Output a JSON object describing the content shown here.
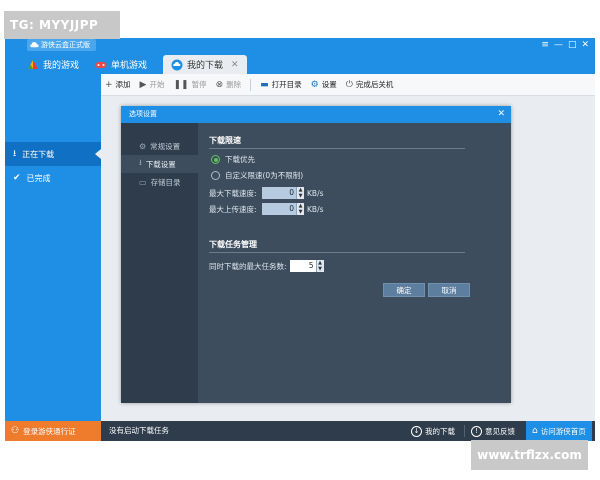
{
  "watermarks": {
    "top_left": "TG: MYYJJPP",
    "bottom_right": "www.trflzx.com"
  },
  "titlebar": {
    "app_title": "游侠云盒正式版",
    "controls": [
      "≡",
      "—",
      "□",
      "✕"
    ]
  },
  "tabs": [
    {
      "label": "我的游戏",
      "icon": "gamepad-colorful-icon"
    },
    {
      "label": "单机游戏",
      "icon": "controller-icon"
    },
    {
      "label": "我的下载",
      "icon": "cloud-download-icon",
      "close": "✕"
    }
  ],
  "sidebar": {
    "items": [
      {
        "label": "正在下载",
        "icon": "download-icon"
      },
      {
        "label": "已完成",
        "icon": "check-icon"
      }
    ]
  },
  "toolbar": {
    "add": "添加",
    "start": "开始",
    "pause": "暂停",
    "delete": "删除",
    "open_dir": "打开目录",
    "settings": "设置",
    "shutdown_after": "完成后关机"
  },
  "dialog": {
    "title": "选项设置",
    "close": "✕",
    "nav": [
      {
        "label": "常规设置",
        "icon": "gear-icon"
      },
      {
        "label": "下载设置",
        "icon": "download-icon"
      },
      {
        "label": "存储目录",
        "icon": "folder-icon"
      }
    ],
    "speed_section": {
      "title": "下载限速",
      "option_priority": "下载优先",
      "option_custom": "自定义限速(0为不限制)",
      "max_download_label": "最大下载速度:",
      "max_download_value": "0",
      "max_upload_label": "最大上传速度:",
      "max_upload_value": "0",
      "unit": "KB/s",
      "selected": "priority"
    },
    "task_section": {
      "title": "下载任务管理",
      "concurrent_label": "同时下载的最大任务数:",
      "concurrent_value": "5"
    },
    "ok": "确定",
    "cancel": "取消"
  },
  "statusbar": {
    "login": "登录游侠通行证",
    "status": "没有启动下载任务",
    "my_downloads": "我的下载",
    "feedback": "意见反馈",
    "visit": "访问游侠首页"
  },
  "colors": {
    "brand_blue": "#1e8fe4",
    "dialog_bg": "#3e4d5d",
    "login_orange": "#ef7b2d",
    "status_dark": "#2f3c4c"
  }
}
